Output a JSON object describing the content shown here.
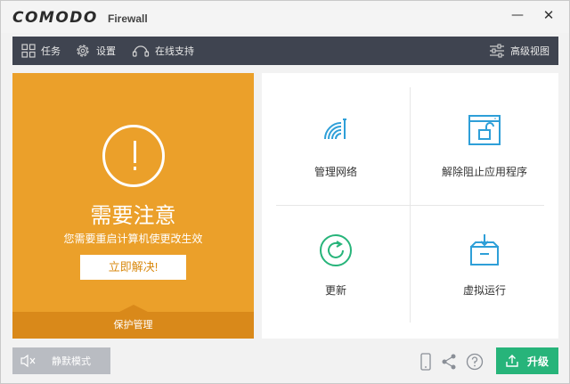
{
  "app": {
    "brand": "COMODO",
    "product": "Firewall"
  },
  "window_controls": {
    "minimize": "—",
    "close": "✕"
  },
  "toolbar": {
    "tasks": "任务",
    "settings": "设置",
    "support": "在线支持",
    "advanced_view": "高级视图"
  },
  "alert": {
    "title": "需要注意",
    "message": "您需要重启计算机使更改生效",
    "fix_button": "立即解决!",
    "protection_tab": "保护管理",
    "color": "#eba02a"
  },
  "actions": [
    {
      "label": "管理网络",
      "icon": "wifi-network-icon"
    },
    {
      "label": "解除阻止应用程序",
      "icon": "unblock-application-icon"
    },
    {
      "label": "更新",
      "icon": "update-refresh-icon"
    },
    {
      "label": "虚拟运行",
      "icon": "virtual-run-box-icon"
    }
  ],
  "footer": {
    "silent_mode": "静默模式",
    "upgrade": "升级",
    "icons": [
      "mobile-icon",
      "share-icon",
      "help-icon"
    ],
    "upgrade_color": "#27b47a"
  }
}
